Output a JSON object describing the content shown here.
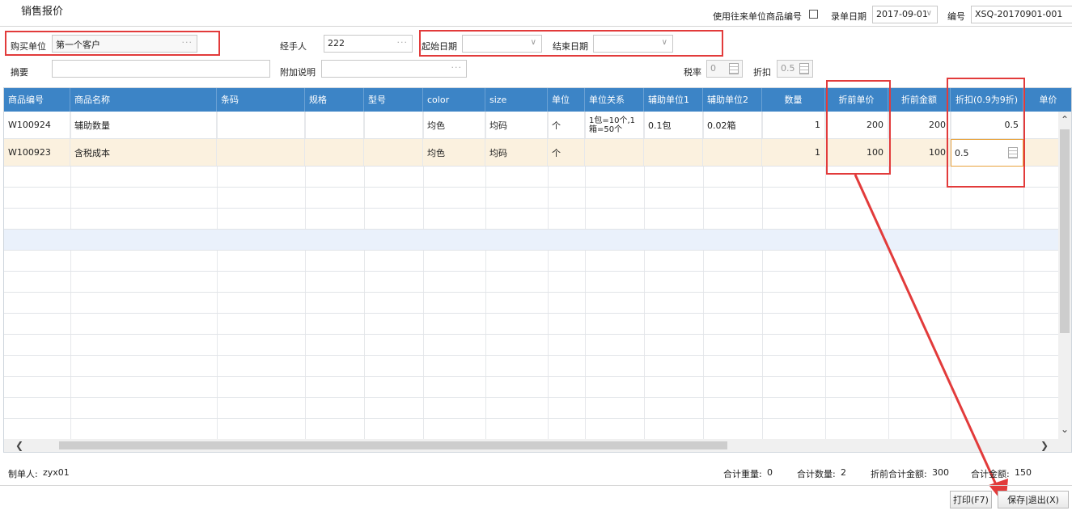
{
  "window": {
    "title": "销售报价"
  },
  "top": {
    "use_code_label": "使用往来单位商品编号",
    "record_date_label": "录单日期",
    "record_date_value": "2017-09-01",
    "number_label": "编号",
    "number_value": "XSQ-20170901-001"
  },
  "form": {
    "buyer_label": "购买单位",
    "buyer_value": "第一个客户",
    "handler_label": "经手人",
    "handler_value": "222",
    "start_date_label": "起始日期",
    "start_date_value": "",
    "end_date_label": "结束日期",
    "end_date_value": "",
    "summary_label": "摘要",
    "summary_value": "",
    "note_label": "附加说明",
    "note_value": "",
    "tax_label": "税率",
    "tax_value": "0",
    "discount_label": "折扣",
    "discount_value": "0.5"
  },
  "table": {
    "columns": [
      "商品编号",
      "商品名称",
      "条码",
      "规格",
      "型号",
      "color",
      "size",
      "单位",
      "单位关系",
      "辅助单位1",
      "辅助单位2",
      "数量",
      "折前单价",
      "折前金额",
      "折扣(0.9为9折)",
      "单价"
    ],
    "rows": [
      {
        "code": "W100924",
        "name": "辅助数量",
        "barcode": "",
        "spec": "",
        "model": "",
        "color": "均色",
        "size": "均码",
        "unit": "个",
        "relation": "1包=10个,1箱=50个",
        "aux1": "0.1包",
        "aux2": "0.02箱",
        "qty": "1",
        "price": "200",
        "amount": "200",
        "discount": "0.5"
      },
      {
        "code": "W100923",
        "name": "含税成本",
        "barcode": "",
        "spec": "",
        "model": "",
        "color": "均色",
        "size": "均码",
        "unit": "个",
        "relation": "",
        "aux1": "",
        "aux2": "",
        "qty": "1",
        "price": "100",
        "amount": "100",
        "discount": "0.5"
      }
    ]
  },
  "footer": {
    "maker_label": "制单人:",
    "maker_value": "zyx01",
    "weight_label": "合计重量:",
    "weight_value": "0",
    "qty_label": "合计数量:",
    "qty_value": "2",
    "pre_total_label": "折前合计金额:",
    "pre_total_value": "300",
    "total_label": "合计金额:",
    "total_value": "150",
    "print_button": "打印(F7)",
    "save_exit_button": "保存|退出(X)"
  },
  "colors": {
    "header_bg": "#3c84c6",
    "annotation_red": "#e23b3b",
    "selected_row": "#fbf1df"
  },
  "icons": [
    "ellipsis-icon",
    "chevron-down-icon",
    "calculator-icon",
    "scroll-up-icon",
    "scroll-down-icon",
    "scroll-left-icon",
    "scroll-right-icon"
  ]
}
